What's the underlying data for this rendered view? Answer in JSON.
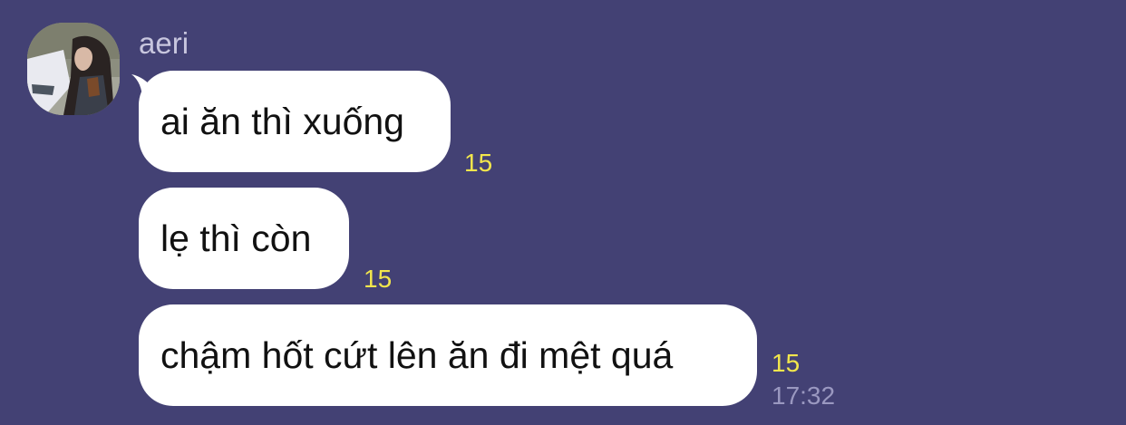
{
  "chat": {
    "sender": {
      "name": "aeri",
      "avatar_icon": "profile-photo"
    },
    "messages": [
      {
        "text": "ai ăn thì xuống",
        "unread_count": "15"
      },
      {
        "text": "lẹ thì còn",
        "unread_count": "15"
      },
      {
        "text": "chậm hốt cứt lên ăn đi mệt quá",
        "unread_count": "15",
        "time": "17:32"
      }
    ]
  },
  "colors": {
    "background": "#434174",
    "bubble": "#ffffff",
    "unread_count": "#f2e64c",
    "time": "#9a98c0"
  }
}
